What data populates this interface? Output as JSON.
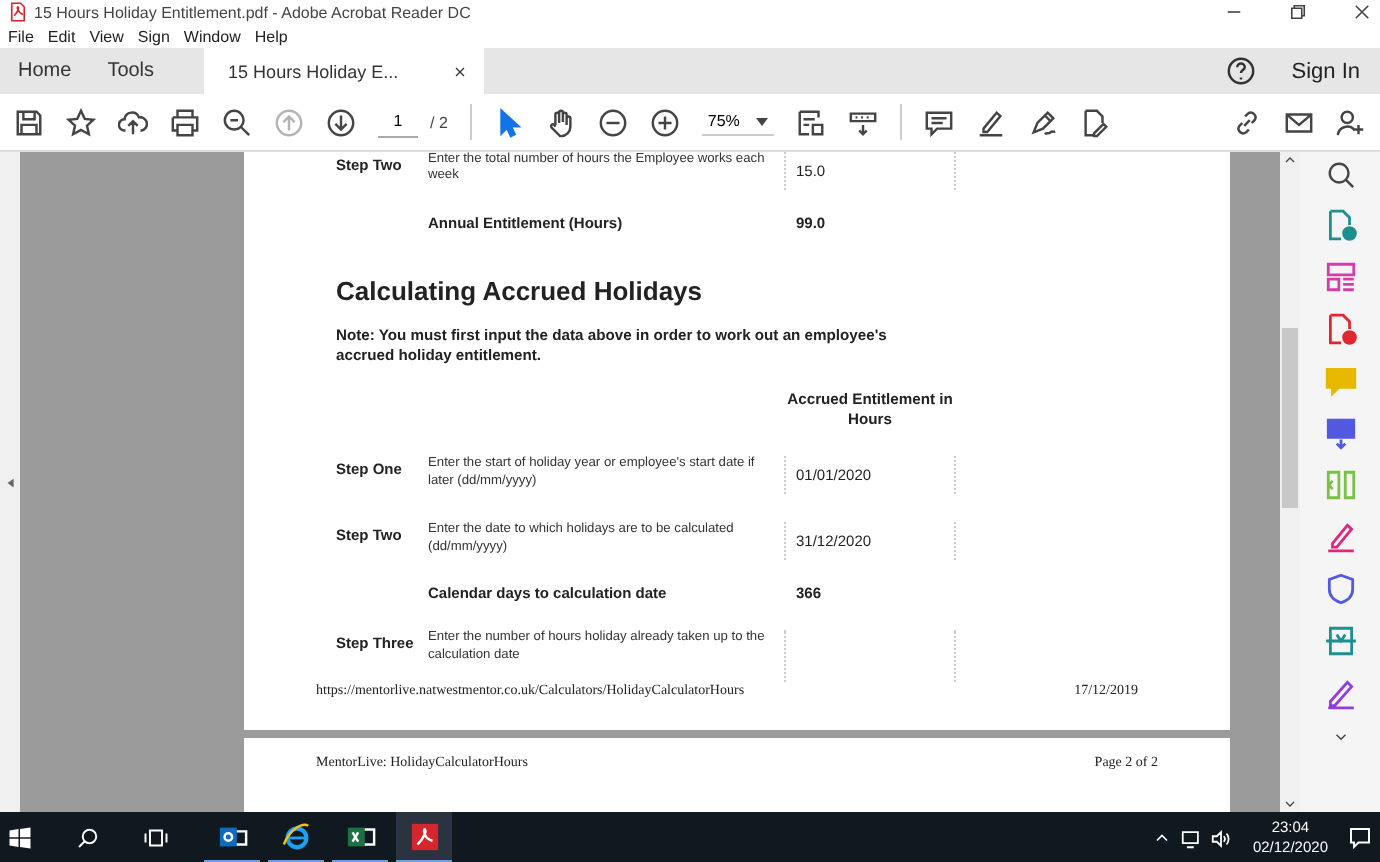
{
  "window": {
    "title": "15 Hours Holiday Entitlement.pdf - Adobe Acrobat Reader DC"
  },
  "menu": [
    "File",
    "Edit",
    "View",
    "Sign",
    "Window",
    "Help"
  ],
  "tabs": [
    {
      "label": "Home",
      "selected": false,
      "kind": "nav"
    },
    {
      "label": "Tools",
      "selected": false,
      "kind": "nav"
    },
    {
      "label": "15 Hours Holiday E...",
      "selected": true,
      "kind": "document"
    }
  ],
  "sign_in": "Sign In",
  "toolbar": {
    "tools": [
      {
        "kind": "save",
        "selected": false
      },
      {
        "kind": "star",
        "selected": false
      },
      {
        "kind": "upload",
        "selected": false
      },
      {
        "kind": "print",
        "selected": false
      },
      {
        "kind": "zoom-search",
        "selected": false
      },
      {
        "kind": "page-up",
        "selected": false,
        "disabled": true
      },
      {
        "kind": "page-down",
        "selected": false,
        "disabled": false
      }
    ],
    "page_number": "1",
    "page_total": "/ 2",
    "tools2": [
      {
        "kind": "pointer",
        "selected": true
      },
      {
        "kind": "hand",
        "selected": false
      },
      {
        "kind": "zoom-out",
        "selected": false
      },
      {
        "kind": "zoom-in",
        "selected": false
      }
    ],
    "zoom": "75%",
    "tools3": [
      {
        "kind": "fit",
        "selected": false
      },
      {
        "kind": "scroll",
        "selected": false
      },
      {
        "kind": "comment",
        "selected": false
      },
      {
        "kind": "highlight",
        "selected": false
      },
      {
        "kind": "sign",
        "selected": false
      },
      {
        "kind": "fill",
        "selected": false
      },
      {
        "kind": "link",
        "selected": false
      },
      {
        "kind": "mail",
        "selected": false
      },
      {
        "kind": "person-add",
        "selected": false
      }
    ]
  },
  "page": {
    "rows": [
      {
        "kind": "step",
        "step": "Step Two",
        "text": "Enter the total number of hours the Employee works each week",
        "value": "15.0"
      },
      {
        "kind": "total",
        "text": "Annual Entitlement (Hours)",
        "value": "99.0"
      },
      {
        "kind": "heading",
        "text": "Calculating Accrued Holidays"
      },
      {
        "kind": "note",
        "text": "Note: You must first input the data above in order to work out an employee's accrued holiday entitlement."
      },
      {
        "kind": "column-header",
        "text": "Accrued Entitlement in Hours"
      },
      {
        "kind": "step",
        "step": "Step One",
        "text": "Enter the start of holiday year or employee's start date if later (dd/mm/yyyy)",
        "value": "01/01/2020"
      },
      {
        "kind": "step",
        "step": "Step Two",
        "text": "Enter the date to which holidays are to be calculated (dd/mm/yyyy)",
        "value": "31/12/2020"
      },
      {
        "kind": "total",
        "text": "Calendar days to calculation date",
        "value": "366"
      },
      {
        "kind": "step",
        "step": "Step Three",
        "text": "Enter the number of hours holiday already taken up to the calculation date"
      }
    ],
    "footer_url": "https://mentorlive.natwestmentor.co.uk/Calculators/HolidayCalculatorHours",
    "footer_date": "17/12/2019"
  },
  "page2": {
    "header_left": "MentorLive: HolidayCalculatorHours",
    "header_right": "Page 2 of 2"
  },
  "side_tools": [
    {
      "kind": "export",
      "color": "#1d8f8f"
    },
    {
      "kind": "organize",
      "color": "#d63ca6"
    },
    {
      "kind": "create",
      "color": "#e0262f"
    },
    {
      "kind": "comment",
      "color": "#e6b800"
    },
    {
      "kind": "combine",
      "color": "#5358e0"
    },
    {
      "kind": "compress",
      "color": "#7ac143"
    },
    {
      "kind": "highlight",
      "color": "#e0267a"
    },
    {
      "kind": "protect",
      "color": "#5358e0"
    },
    {
      "kind": "scan",
      "color": "#1d8f8f"
    },
    {
      "kind": "edit",
      "color": "#8f3ce0"
    }
  ],
  "taskbar": {
    "apps": [
      {
        "kind": "outlook",
        "selected": false
      },
      {
        "kind": "browser",
        "selected": false
      },
      {
        "kind": "excel",
        "selected": false
      },
      {
        "kind": "acrobat",
        "selected": true
      }
    ],
    "time": "23:04",
    "date": "02/12/2020"
  }
}
